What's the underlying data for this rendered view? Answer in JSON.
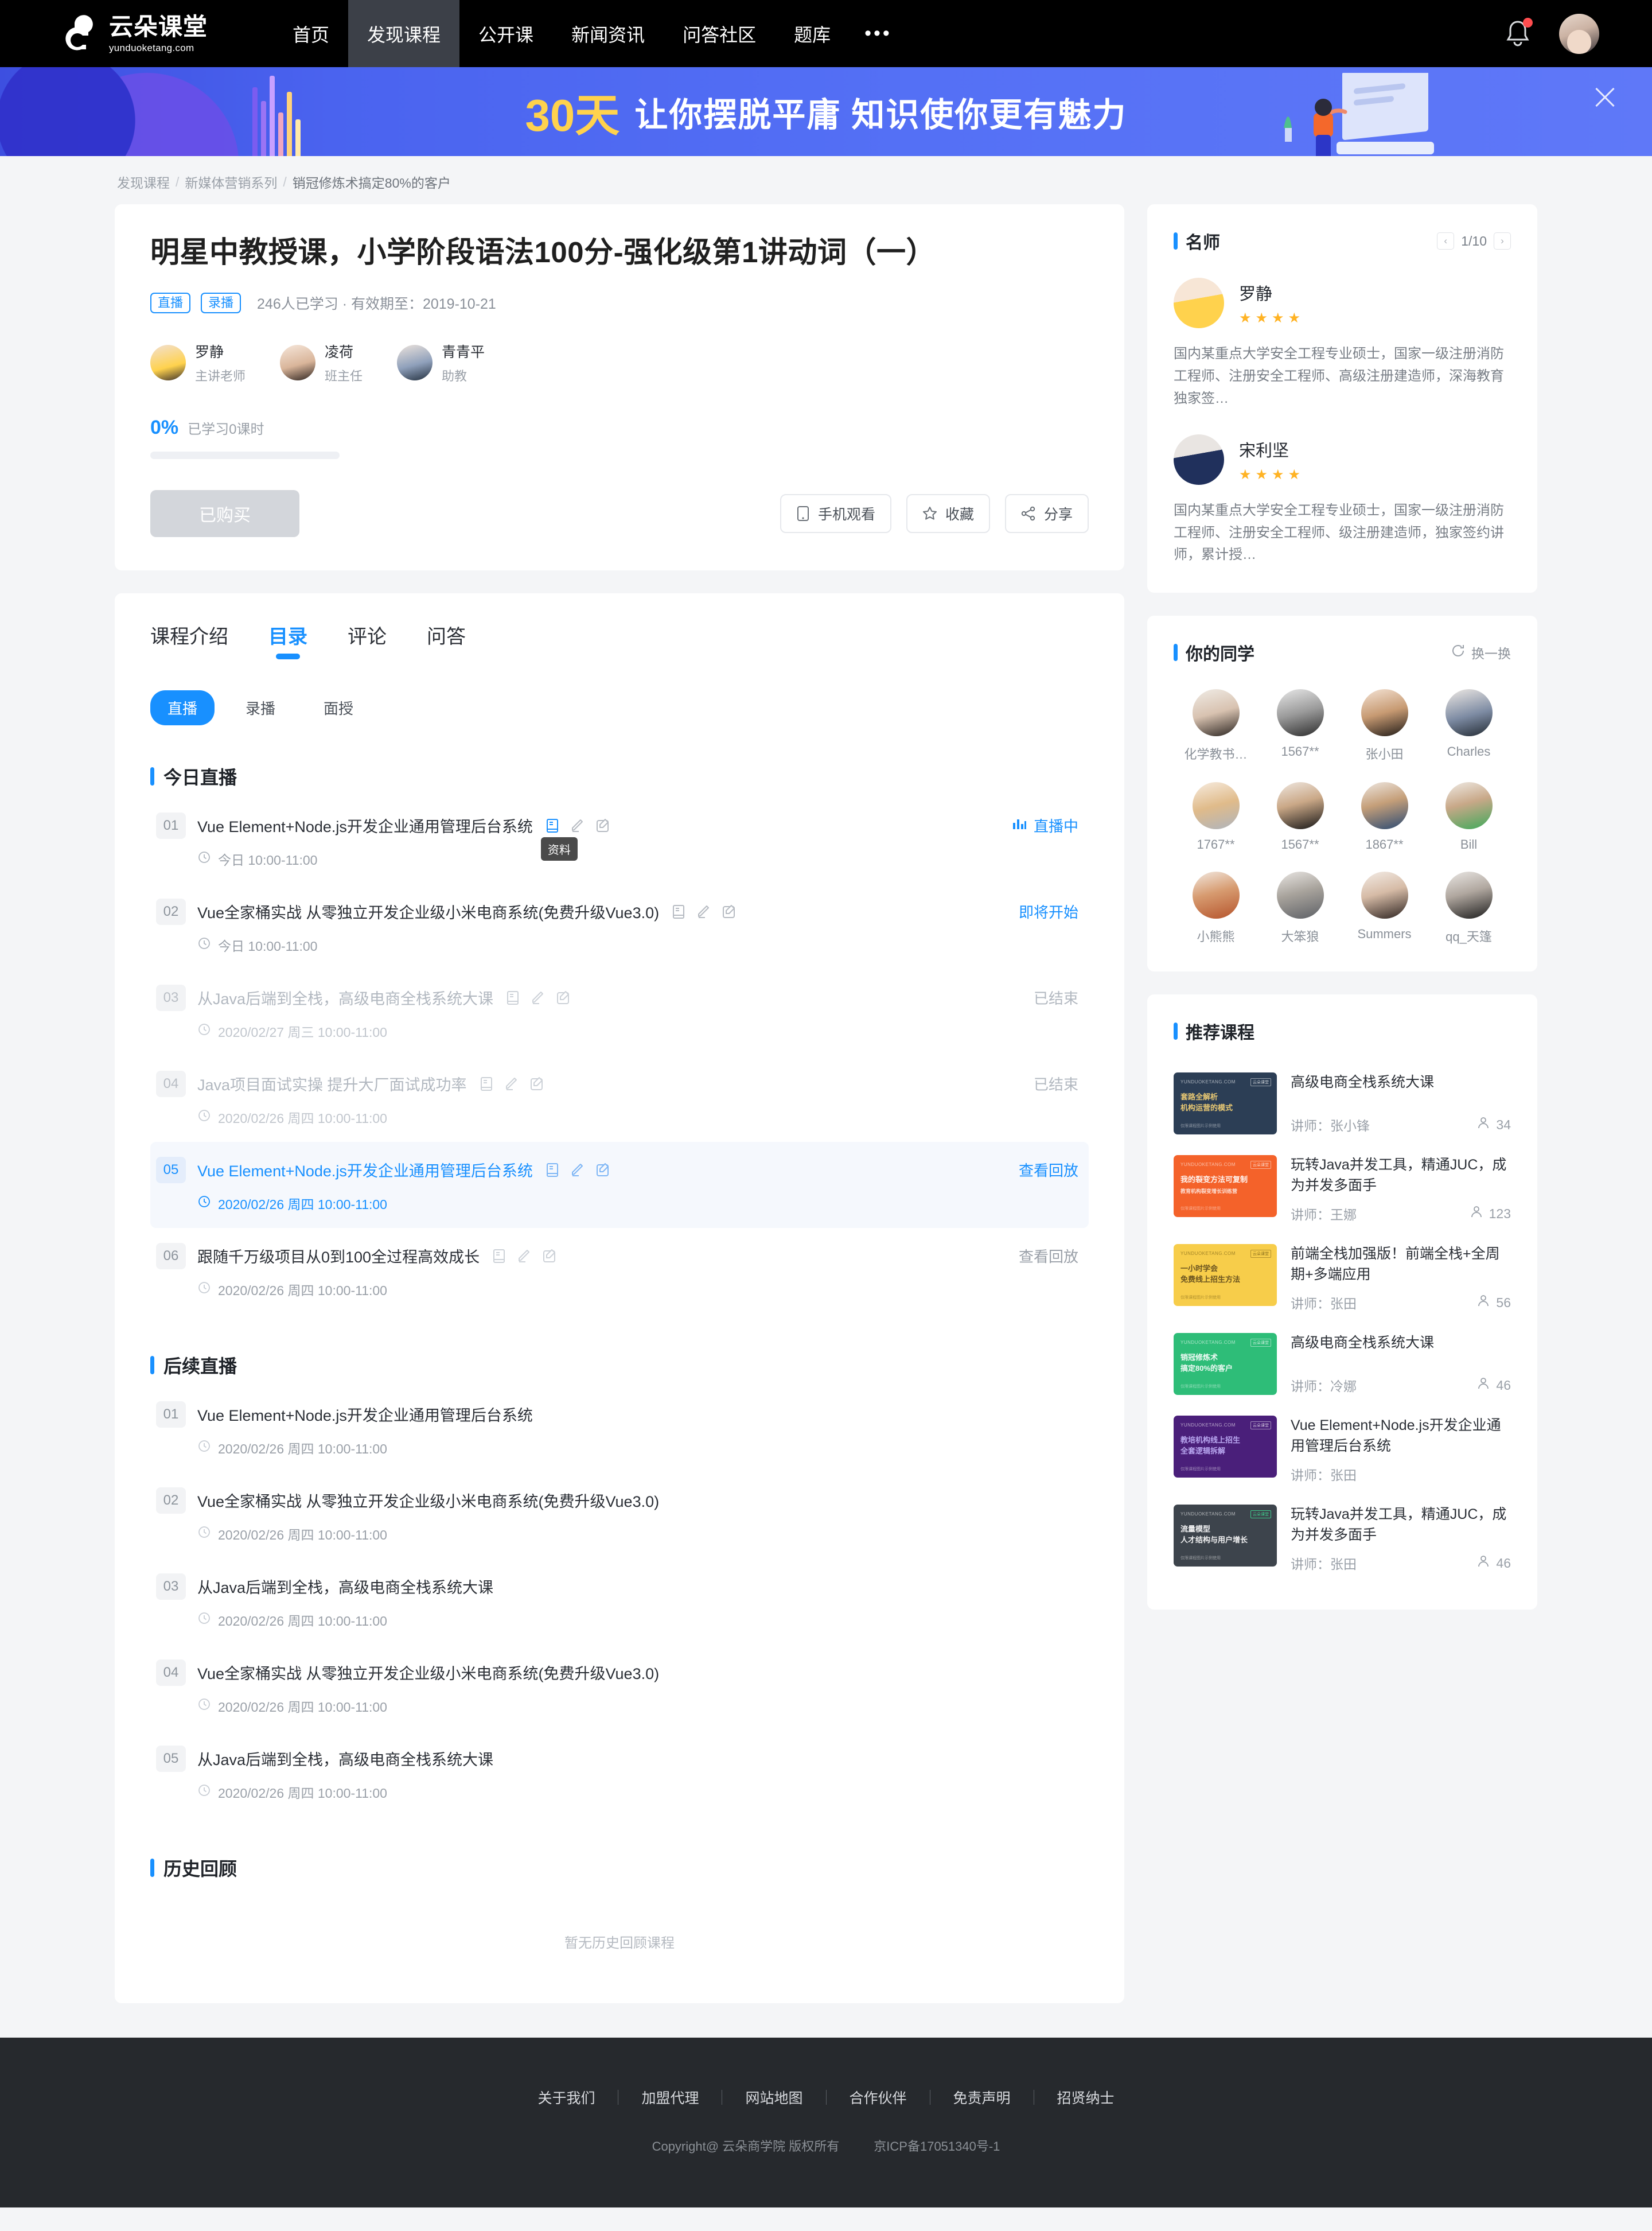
{
  "nav": {
    "logo_cn": "云朵课堂",
    "logo_en": "yunduoketang.com",
    "items": [
      {
        "label": "首页",
        "active": false
      },
      {
        "label": "发现课程",
        "active": true
      },
      {
        "label": "公开课",
        "active": false
      },
      {
        "label": "新闻资讯",
        "active": false
      },
      {
        "label": "问答社区",
        "active": false
      },
      {
        "label": "题库",
        "active": false
      }
    ],
    "more": "•••"
  },
  "banner": {
    "highlight": "30天",
    "text": "让你摆脱平庸  知识使你更有魅力"
  },
  "breadcrumb": {
    "items": [
      "发现课程",
      "新媒体营销系列",
      "销冠修炼术搞定80%的客户"
    ]
  },
  "course": {
    "title": "明星中教授课，小学阶段语法100分-强化级第1讲动词（一）",
    "tags": [
      "直播",
      "录播"
    ],
    "meta": "246人已学习 · 有效期至：2019-10-21",
    "teachers": [
      {
        "name": "罗静",
        "role": "主讲老师"
      },
      {
        "name": "凌荷",
        "role": "班主任"
      },
      {
        "name": "青青平",
        "role": "助教"
      }
    ],
    "progress_pct": "0%",
    "progress_label": "已学习0课时",
    "progress_value": 0,
    "buy_button": "已购买",
    "actions": [
      {
        "label": "手机观看",
        "icon": "phone-icon"
      },
      {
        "label": "收藏",
        "icon": "star-icon"
      },
      {
        "label": "分享",
        "icon": "share-icon"
      }
    ]
  },
  "catalog": {
    "tabs": [
      {
        "label": "课程介绍",
        "active": false
      },
      {
        "label": "目录",
        "active": true
      },
      {
        "label": "评论",
        "active": false
      },
      {
        "label": "问答",
        "active": false
      }
    ],
    "subtabs": [
      {
        "label": "直播",
        "active": true
      },
      {
        "label": "录播",
        "active": false
      },
      {
        "label": "面授",
        "active": false
      }
    ],
    "tooltip": "资料",
    "sections": [
      {
        "title": "今日直播",
        "lessons": [
          {
            "idx": "01",
            "title": "Vue Element+Node.js开发企业通用管理后台系统",
            "time": "今日 10:00-11:00",
            "status": "直播中",
            "state": "live",
            "icons": true,
            "icon_active": true,
            "tooltip": true
          },
          {
            "idx": "02",
            "title": "Vue全家桶实战 从零独立开发企业级小米电商系统(免费升级Vue3.0)",
            "time": "今日 10:00-11:00",
            "status": "即将开始",
            "state": "soon",
            "icons": true
          },
          {
            "idx": "03",
            "title": "从Java后端到全栈，高级电商全栈系统大课",
            "time": "2020/02/27 周三 10:00-11:00",
            "status": "已结束",
            "state": "ended",
            "icons": true
          },
          {
            "idx": "04",
            "title": "Java项目面试实操 提升大厂面试成功率",
            "time": "2020/02/26 周四 10:00-11:00",
            "status": "已结束",
            "state": "ended",
            "icons": true
          },
          {
            "idx": "05",
            "title": "Vue Element+Node.js开发企业通用管理后台系统",
            "time": "2020/02/26 周四 10:00-11:00",
            "status": "查看回放",
            "state": "highlight",
            "icons": true
          },
          {
            "idx": "06",
            "title": "跟随千万级项目从0到100全过程高效成长",
            "time": "2020/02/26 周四 10:00-11:00",
            "status": "查看回放",
            "state": "replay",
            "icons": true
          }
        ]
      },
      {
        "title": "后续直播",
        "lessons": [
          {
            "idx": "01",
            "title": "Vue Element+Node.js开发企业通用管理后台系统",
            "time": "2020/02/26 周四 10:00-11:00",
            "status": "",
            "state": "plain",
            "icons": false
          },
          {
            "idx": "02",
            "title": "Vue全家桶实战 从零独立开发企业级小米电商系统(免费升级Vue3.0)",
            "time": "2020/02/26 周四 10:00-11:00",
            "status": "",
            "state": "plain",
            "icons": false
          },
          {
            "idx": "03",
            "title": "从Java后端到全栈，高级电商全栈系统大课",
            "time": "2020/02/26 周四 10:00-11:00",
            "status": "",
            "state": "plain",
            "icons": false
          },
          {
            "idx": "04",
            "title": "Vue全家桶实战 从零独立开发企业级小米电商系统(免费升级Vue3.0)",
            "time": "2020/02/26 周四 10:00-11:00",
            "status": "",
            "state": "plain",
            "icons": false
          },
          {
            "idx": "05",
            "title": "从Java后端到全栈，高级电商全栈系统大课",
            "time": "2020/02/26 周四 10:00-11:00",
            "status": "",
            "state": "plain",
            "icons": false
          }
        ]
      },
      {
        "title": "历史回顾",
        "lessons": [],
        "empty": "暂无历史回顾课程"
      }
    ]
  },
  "sidebar": {
    "famous": {
      "title": "名师",
      "page": "1/10",
      "prev": "‹",
      "next": "›",
      "teachers": [
        {
          "name": "罗静",
          "stars": 4,
          "desc": "国内某重点大学安全工程专业硕士，国家一级注册消防工程师、注册安全工程师、高级注册建造师，深海教育独家签…"
        },
        {
          "name": "宋利坚",
          "stars": 4,
          "desc": "国内某重点大学安全工程专业硕士，国家一级注册消防工程师、注册安全工程师、级注册建造师，独家签约讲师，累计授…"
        }
      ]
    },
    "classmates": {
      "title": "你的同学",
      "refresh": "换一换",
      "people": [
        {
          "name": "化学教书…"
        },
        {
          "name": "1567**"
        },
        {
          "name": "张小田"
        },
        {
          "name": "Charles"
        },
        {
          "name": "1767**"
        },
        {
          "name": "1567**"
        },
        {
          "name": "1867**"
        },
        {
          "name": "Bill"
        },
        {
          "name": "小熊熊"
        },
        {
          "name": "大笨狼"
        },
        {
          "name": "Summers"
        },
        {
          "name": "qq_天篷"
        }
      ]
    },
    "recommend": {
      "title": "推荐课程",
      "teacher_prefix": "讲师：",
      "courses": [
        {
          "title": "高级电商全栈系统大课",
          "teacher": "张小锋",
          "count": "34",
          "thumb_color": "#2c3e55",
          "thumb_l1": "套路全解析",
          "thumb_l2": "机构运营的模式",
          "accent": "#e8c873"
        },
        {
          "title": "玩转Java并发工具，精通JUC，成为并发多面手",
          "teacher": "王娜",
          "count": "123",
          "thumb_color": "#f4622a",
          "thumb_l1": "我的裂变方法可复制",
          "thumb_l2": "教育机构裂变增长训练营",
          "accent": "#ffffff"
        },
        {
          "title": "前端全栈加强版！前端全栈+全周期+多端应用",
          "teacher": "张田",
          "count": "56",
          "thumb_color": "#f7cd4a",
          "thumb_l1": "一小时学会",
          "thumb_l2": "免费线上招生方法",
          "accent": "#6b5420"
        },
        {
          "title": "高级电商全栈系统大课",
          "teacher": "冷娜",
          "count": "46",
          "thumb_color": "#2ebd78",
          "thumb_l1": "销冠修炼术",
          "thumb_l2": "搞定80%的客户",
          "accent": "#ffffff"
        },
        {
          "title": "Vue Element+Node.js开发企业通用管理后台系统",
          "teacher": "张田",
          "count": "",
          "thumb_color": "#4a1f7a",
          "thumb_l1": "教培机构线上招生",
          "thumb_l2": "全套逻辑拆解",
          "accent": "#b9a7f0"
        },
        {
          "title": "玩转Java并发工具，精通JUC，成为并发多面手",
          "teacher": "张田",
          "count": "46",
          "thumb_color": "#3d444c",
          "thumb_l1": "流量模型",
          "thumb_l2": "人才结构与用户增长",
          "accent": "#ffffff"
        }
      ]
    }
  },
  "footer": {
    "links": [
      "关于我们",
      "加盟代理",
      "网站地图",
      "合作伙伴",
      "免责声明",
      "招贤纳士"
    ],
    "copyright": "Copyright@ 云朵商学院  版权所有",
    "icp": "京ICP备17051340号-1"
  },
  "colors": {
    "accent": "#1890ff",
    "nav_bg": "#000000",
    "banner_bg": "#5470f5",
    "footer_bg": "#26292d"
  }
}
